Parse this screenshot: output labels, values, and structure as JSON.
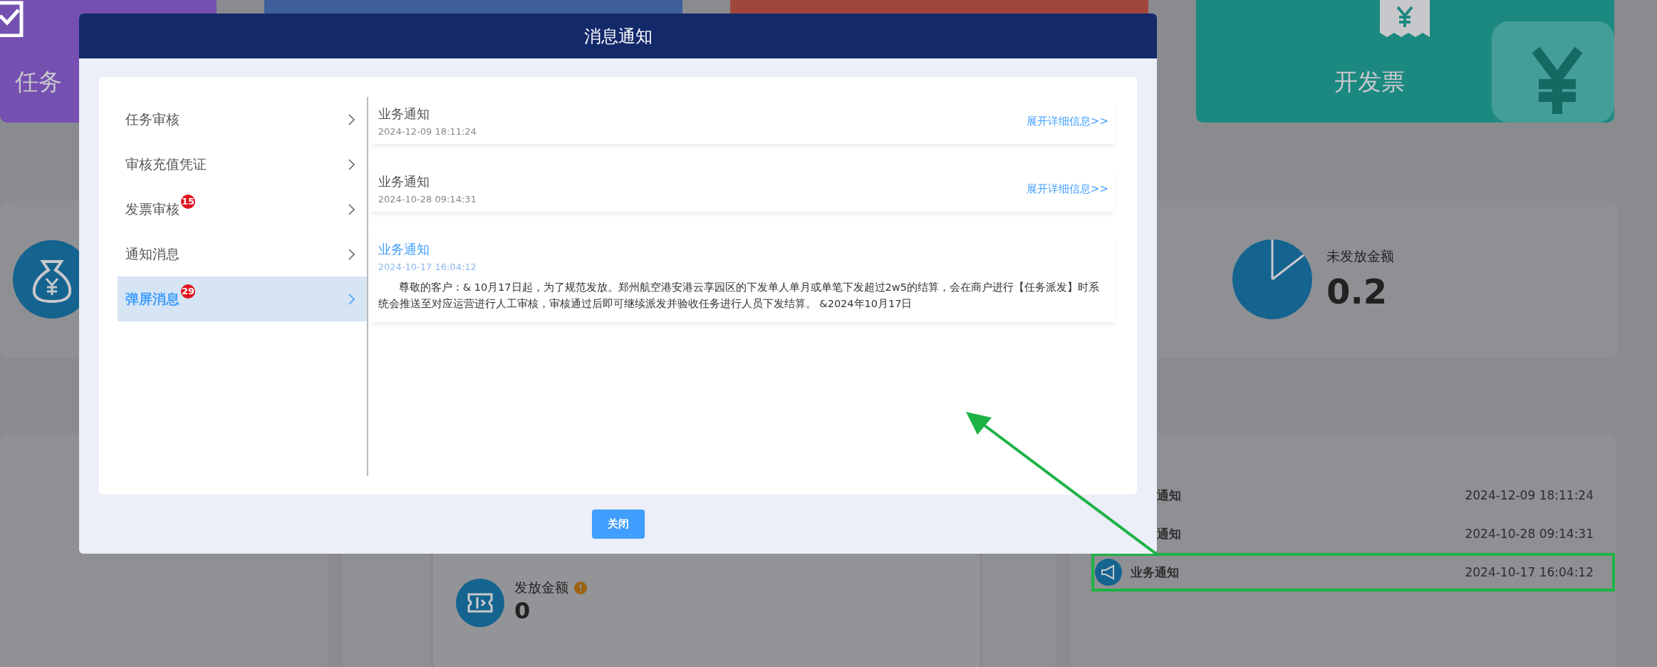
{
  "background": {
    "top_cards": [
      {
        "label": "任务",
        "color": "#7550b0",
        "kind": "task"
      },
      {
        "color": "#3e5e9c",
        "kind": "plain"
      },
      {
        "color": "#a0473c",
        "kind": "plain"
      },
      {
        "label": "开发票",
        "color": "#1c8980",
        "kind": "invoice"
      }
    ],
    "stat": {
      "label": "未发放金额",
      "value": "0.2"
    },
    "amount_card": {
      "label": "发放金额",
      "value": "0"
    },
    "notices": [
      {
        "title": "通知",
        "time": "2024-12-09 18:11:24",
        "covered": true,
        "highlighted": false
      },
      {
        "title": "通知",
        "time": "2024-10-28 09:14:31",
        "covered": true,
        "highlighted": false
      },
      {
        "title": "业务通知",
        "time": "2024-10-17 16:04:12",
        "covered": false,
        "highlighted": true
      }
    ]
  },
  "modal": {
    "title": "消息通知",
    "menu": [
      {
        "label": "任务审核",
        "selected": false
      },
      {
        "label": "审核充值凭证",
        "selected": false
      },
      {
        "label": "发票审核",
        "badge": "15",
        "selected": false
      },
      {
        "label": "通知消息",
        "selected": false
      },
      {
        "label": "弹屏消息",
        "badge": "29",
        "selected": true
      }
    ],
    "messages": [
      {
        "title": "业务通知",
        "time": "2024-12-09 18:11:24",
        "link": "展开详细信息>>",
        "expanded": false
      },
      {
        "title": "业务通知",
        "time": "2024-10-28 09:14:31",
        "link": "展开详细信息>>",
        "expanded": false
      },
      {
        "title": "业务通知",
        "time": "2024-10-17 16:04:12",
        "expanded": true,
        "body": "尊敬的客户：& 10月17日起，为了规范发放。郑州航空港安港云享园区的下发单人单月或单笔下发超过2w5的结算，会在商户进行【任务派发】时系统会推送至对应运营进行人工审核，审核通过后即可继续派发并验收任务进行人员下发结算。 &2024年10月17日"
      }
    ],
    "close_button": "关闭"
  }
}
